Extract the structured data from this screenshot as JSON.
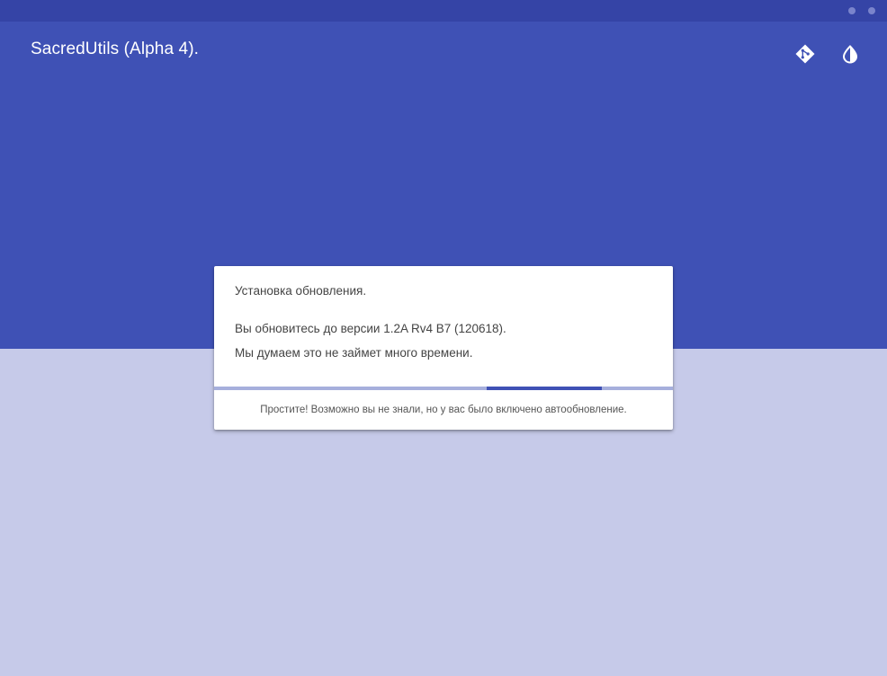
{
  "window": {
    "title": "SacredUtils (Alpha 4).",
    "controls": [
      "window-dot",
      "window-dot"
    ]
  },
  "header": {
    "icons": [
      {
        "name": "git-icon",
        "label": "git"
      },
      {
        "name": "theme-toggle-icon",
        "label": "theme"
      }
    ]
  },
  "dialog": {
    "title": "Установка обновления.",
    "line1": "Вы обновитесь до версии 1.2A Rv4 B7 (120618).",
    "line2": "Мы думаем это не займет много времени.",
    "progress": "indeterminate",
    "footer": "Простите! Возможно вы не знали, но у вас было включено автообновление."
  },
  "colors": {
    "primary": "#3f51b5",
    "primary_dark": "#3544a6",
    "background_light": "#c6cae9",
    "progress_track": "#a6afdc",
    "dialog_bg": "#ffffff"
  }
}
